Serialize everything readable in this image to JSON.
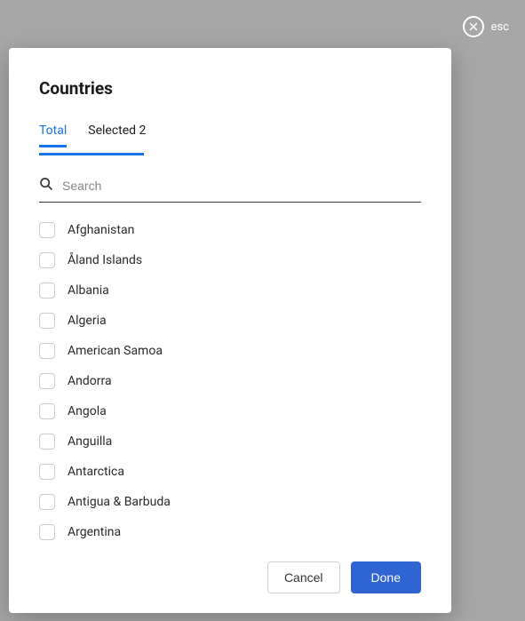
{
  "esc": {
    "label": "esc"
  },
  "modal": {
    "title": "Countries",
    "tabs": {
      "total": {
        "label": "Total"
      },
      "selected": {
        "label_prefix": "Selected",
        "count": 2
      }
    },
    "search": {
      "placeholder": "Search"
    },
    "items": [
      {
        "label": "Afghanistan"
      },
      {
        "label": "Åland Islands"
      },
      {
        "label": "Albania"
      },
      {
        "label": "Algeria"
      },
      {
        "label": "American Samoa"
      },
      {
        "label": "Andorra"
      },
      {
        "label": "Angola"
      },
      {
        "label": "Anguilla"
      },
      {
        "label": "Antarctica"
      },
      {
        "label": "Antigua & Barbuda"
      },
      {
        "label": "Argentina"
      }
    ],
    "footer": {
      "cancel": "Cancel",
      "done": "Done"
    }
  }
}
